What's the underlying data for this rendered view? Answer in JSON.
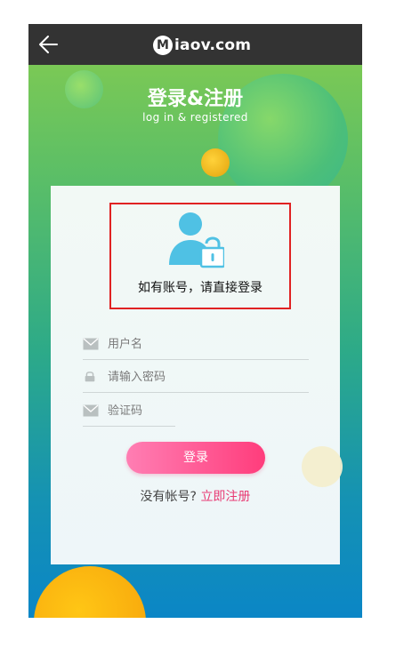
{
  "header": {
    "logo_letter": "M",
    "logo_text": "iaov.com",
    "back_icon": "arrow-left-icon"
  },
  "hero": {
    "title": "登录&注册",
    "subtitle": "log in & registered"
  },
  "card": {
    "avatar_icon": "user-lock-icon",
    "hint": "如有账号，请直接登录",
    "fields": {
      "username": {
        "placeholder": "用户名",
        "icon": "mail-icon"
      },
      "password": {
        "placeholder": "请输入密码",
        "icon": "lock-icon"
      },
      "captcha": {
        "placeholder": "验证码",
        "icon": "mail-icon"
      }
    },
    "login_button": "登录",
    "register_prompt": "没有帐号?",
    "register_link": "立即注册"
  },
  "colors": {
    "topbar": "#333333",
    "accent_pink": "#ff3d7c",
    "link_pink": "#e83a73",
    "highlight_red": "#e02222",
    "avatar_blue": "#4fc1e4"
  }
}
